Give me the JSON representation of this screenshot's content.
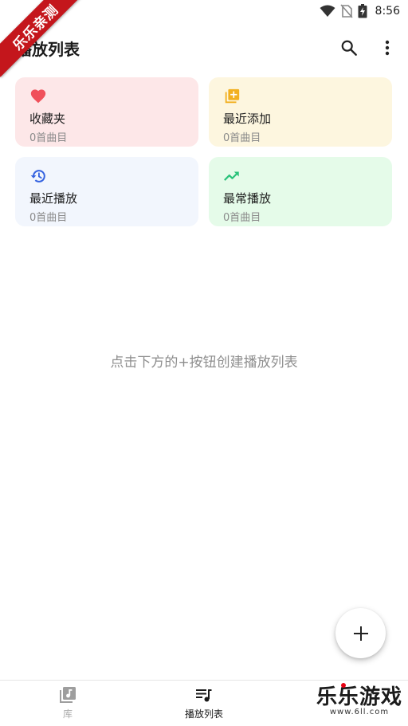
{
  "status_bar": {
    "time": "8:56"
  },
  "ribbon": {
    "text": "乐乐亲测"
  },
  "header": {
    "title": "播放列表",
    "search_icon": "search-icon",
    "more_icon": "more-vert-icon"
  },
  "cards": [
    {
      "icon": "heart-icon",
      "title": "收藏夹",
      "subtitle": "0首曲目",
      "bg": "#fde7e8",
      "icon_color": "#f0505a"
    },
    {
      "icon": "playlist-add-icon",
      "title": "最近添加",
      "subtitle": "0首曲目",
      "bg": "#fdf6df",
      "icon_color": "#f2b020"
    },
    {
      "icon": "history-icon",
      "title": "最近播放",
      "subtitle": "0首曲目",
      "bg": "#f2f6fd",
      "icon_color": "#3563e0"
    },
    {
      "icon": "trending-up-icon",
      "title": "最常播放",
      "subtitle": "0首曲目",
      "bg": "#e5fbe9",
      "icon_color": "#2ac27a"
    }
  ],
  "empty_state": {
    "message": "点击下方的+按钮创建播放列表"
  },
  "fab": {
    "icon": "plus-icon"
  },
  "bottom_nav": {
    "items": [
      {
        "label": "库",
        "icon": "library-music-icon",
        "active": false
      },
      {
        "label": "播放列表",
        "icon": "queue-music-icon",
        "active": true
      }
    ]
  },
  "watermark": {
    "text": "乐乐游戏",
    "url": "www.6ll.com"
  }
}
